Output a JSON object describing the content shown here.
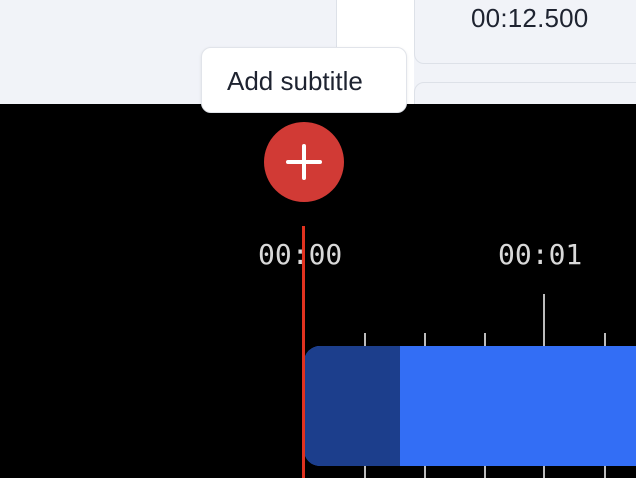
{
  "editor": {
    "subtitle_end_time": "00:12.500"
  },
  "tooltip": {
    "label": "Add subtitle"
  },
  "add_button": {
    "icon": "plus-icon",
    "color": "#d13a35"
  },
  "timeline": {
    "time_labels": [
      "00:00",
      "00:01"
    ],
    "playhead_color": "#e0321f",
    "clip_color": "#336ef5",
    "clip_selected_color": "#1c3e8c"
  }
}
